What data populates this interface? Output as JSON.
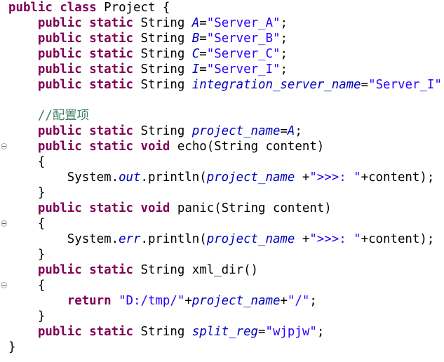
{
  "editor": {
    "lines": [
      [
        {
          "t": "public",
          "c": "kw"
        },
        {
          "t": " ",
          "c": "pl"
        },
        {
          "t": "class",
          "c": "kw"
        },
        {
          "t": " Project {",
          "c": "pl"
        }
      ],
      [
        {
          "t": "    ",
          "c": "pl"
        },
        {
          "t": "public",
          "c": "kw"
        },
        {
          "t": " ",
          "c": "pl"
        },
        {
          "t": "static",
          "c": "kw"
        },
        {
          "t": " String ",
          "c": "pl"
        },
        {
          "t": "A",
          "c": "fld"
        },
        {
          "t": "=",
          "c": "pl"
        },
        {
          "t": "\"Server_A\"",
          "c": "str"
        },
        {
          "t": ";",
          "c": "pl"
        }
      ],
      [
        {
          "t": "    ",
          "c": "pl"
        },
        {
          "t": "public",
          "c": "kw"
        },
        {
          "t": " ",
          "c": "pl"
        },
        {
          "t": "static",
          "c": "kw"
        },
        {
          "t": " String ",
          "c": "pl"
        },
        {
          "t": "B",
          "c": "fld"
        },
        {
          "t": "=",
          "c": "pl"
        },
        {
          "t": "\"Server_B\"",
          "c": "str"
        },
        {
          "t": ";",
          "c": "pl"
        }
      ],
      [
        {
          "t": "    ",
          "c": "pl"
        },
        {
          "t": "public",
          "c": "kw"
        },
        {
          "t": " ",
          "c": "pl"
        },
        {
          "t": "static",
          "c": "kw"
        },
        {
          "t": " String ",
          "c": "pl"
        },
        {
          "t": "C",
          "c": "fld"
        },
        {
          "t": "=",
          "c": "pl"
        },
        {
          "t": "\"Server_C\"",
          "c": "str"
        },
        {
          "t": ";",
          "c": "pl"
        }
      ],
      [
        {
          "t": "    ",
          "c": "pl"
        },
        {
          "t": "public",
          "c": "kw"
        },
        {
          "t": " ",
          "c": "pl"
        },
        {
          "t": "static",
          "c": "kw"
        },
        {
          "t": " String ",
          "c": "pl"
        },
        {
          "t": "I",
          "c": "fld"
        },
        {
          "t": "=",
          "c": "pl"
        },
        {
          "t": "\"Server_I\"",
          "c": "str"
        },
        {
          "t": ";",
          "c": "pl"
        }
      ],
      [
        {
          "t": "    ",
          "c": "pl"
        },
        {
          "t": "public",
          "c": "kw"
        },
        {
          "t": " ",
          "c": "pl"
        },
        {
          "t": "static",
          "c": "kw"
        },
        {
          "t": " String ",
          "c": "pl"
        },
        {
          "t": "integration_server_name",
          "c": "fld"
        },
        {
          "t": "=",
          "c": "pl"
        },
        {
          "t": "\"Server_I\"",
          "c": "str"
        },
        {
          "t": ";",
          "c": "pl"
        }
      ],
      [],
      [
        {
          "t": "    ",
          "c": "pl"
        },
        {
          "t": "//配置项",
          "c": "cm"
        }
      ],
      [
        {
          "t": "    ",
          "c": "pl"
        },
        {
          "t": "public",
          "c": "kw"
        },
        {
          "t": " ",
          "c": "pl"
        },
        {
          "t": "static",
          "c": "kw"
        },
        {
          "t": " String ",
          "c": "pl"
        },
        {
          "t": "project_name",
          "c": "fld"
        },
        {
          "t": "=",
          "c": "pl"
        },
        {
          "t": "A",
          "c": "fld"
        },
        {
          "t": ";",
          "c": "pl"
        }
      ],
      [
        {
          "t": "    ",
          "c": "pl"
        },
        {
          "t": "public",
          "c": "kw"
        },
        {
          "t": " ",
          "c": "pl"
        },
        {
          "t": "static",
          "c": "kw"
        },
        {
          "t": " ",
          "c": "pl"
        },
        {
          "t": "void",
          "c": "kw"
        },
        {
          "t": " echo(String content)",
          "c": "pl"
        }
      ],
      [
        {
          "t": "    {",
          "c": "pl"
        }
      ],
      [
        {
          "t": "        System.",
          "c": "pl"
        },
        {
          "t": "out",
          "c": "fld"
        },
        {
          "t": ".println(",
          "c": "pl"
        },
        {
          "t": "project_name",
          "c": "fld"
        },
        {
          "t": " +",
          "c": "pl"
        },
        {
          "t": "\">>>: \"",
          "c": "str"
        },
        {
          "t": "+content);",
          "c": "pl"
        }
      ],
      [
        {
          "t": "    }",
          "c": "pl"
        }
      ],
      [
        {
          "t": "    ",
          "c": "pl"
        },
        {
          "t": "public",
          "c": "kw"
        },
        {
          "t": " ",
          "c": "pl"
        },
        {
          "t": "static",
          "c": "kw"
        },
        {
          "t": " ",
          "c": "pl"
        },
        {
          "t": "void",
          "c": "kw"
        },
        {
          "t": " panic(String content)",
          "c": "pl"
        }
      ],
      [
        {
          "t": "    {",
          "c": "pl"
        }
      ],
      [
        {
          "t": "        System.",
          "c": "pl"
        },
        {
          "t": "err",
          "c": "fld"
        },
        {
          "t": ".println(",
          "c": "pl"
        },
        {
          "t": "project_name",
          "c": "fld"
        },
        {
          "t": " +",
          "c": "pl"
        },
        {
          "t": "\">>>: \"",
          "c": "str"
        },
        {
          "t": "+content);",
          "c": "pl"
        }
      ],
      [
        {
          "t": "    }",
          "c": "pl"
        }
      ],
      [
        {
          "t": "    ",
          "c": "pl"
        },
        {
          "t": "public",
          "c": "kw"
        },
        {
          "t": " ",
          "c": "pl"
        },
        {
          "t": "static",
          "c": "kw"
        },
        {
          "t": " String xml_dir()",
          "c": "pl"
        }
      ],
      [
        {
          "t": "    {",
          "c": "pl"
        }
      ],
      [
        {
          "t": "        ",
          "c": "pl"
        },
        {
          "t": "return",
          "c": "kw"
        },
        {
          "t": " ",
          "c": "pl"
        },
        {
          "t": "\"D:/tmp/\"",
          "c": "str"
        },
        {
          "t": "+",
          "c": "pl"
        },
        {
          "t": "project_name",
          "c": "fld"
        },
        {
          "t": "+",
          "c": "pl"
        },
        {
          "t": "\"/\"",
          "c": "str"
        },
        {
          "t": ";",
          "c": "pl"
        }
      ],
      [
        {
          "t": "    }",
          "c": "pl"
        }
      ],
      [
        {
          "t": "    ",
          "c": "pl"
        },
        {
          "t": "public",
          "c": "kw"
        },
        {
          "t": " ",
          "c": "pl"
        },
        {
          "t": "static",
          "c": "kw"
        },
        {
          "t": " String ",
          "c": "pl"
        },
        {
          "t": "split_reg",
          "c": "fld"
        },
        {
          "t": "=",
          "c": "pl"
        },
        {
          "t": "\"wjpjw\"",
          "c": "str"
        },
        {
          "t": ";",
          "c": "pl"
        }
      ],
      [
        {
          "t": "}",
          "c": "pl"
        }
      ]
    ],
    "fold_markers": [
      9,
      14,
      18
    ],
    "colors": {
      "keyword": "#7f0055",
      "string": "#2a00ff",
      "field": "#0000c0",
      "comment": "#3f7f5f",
      "text": "#000000",
      "background": "#ffffff"
    }
  }
}
